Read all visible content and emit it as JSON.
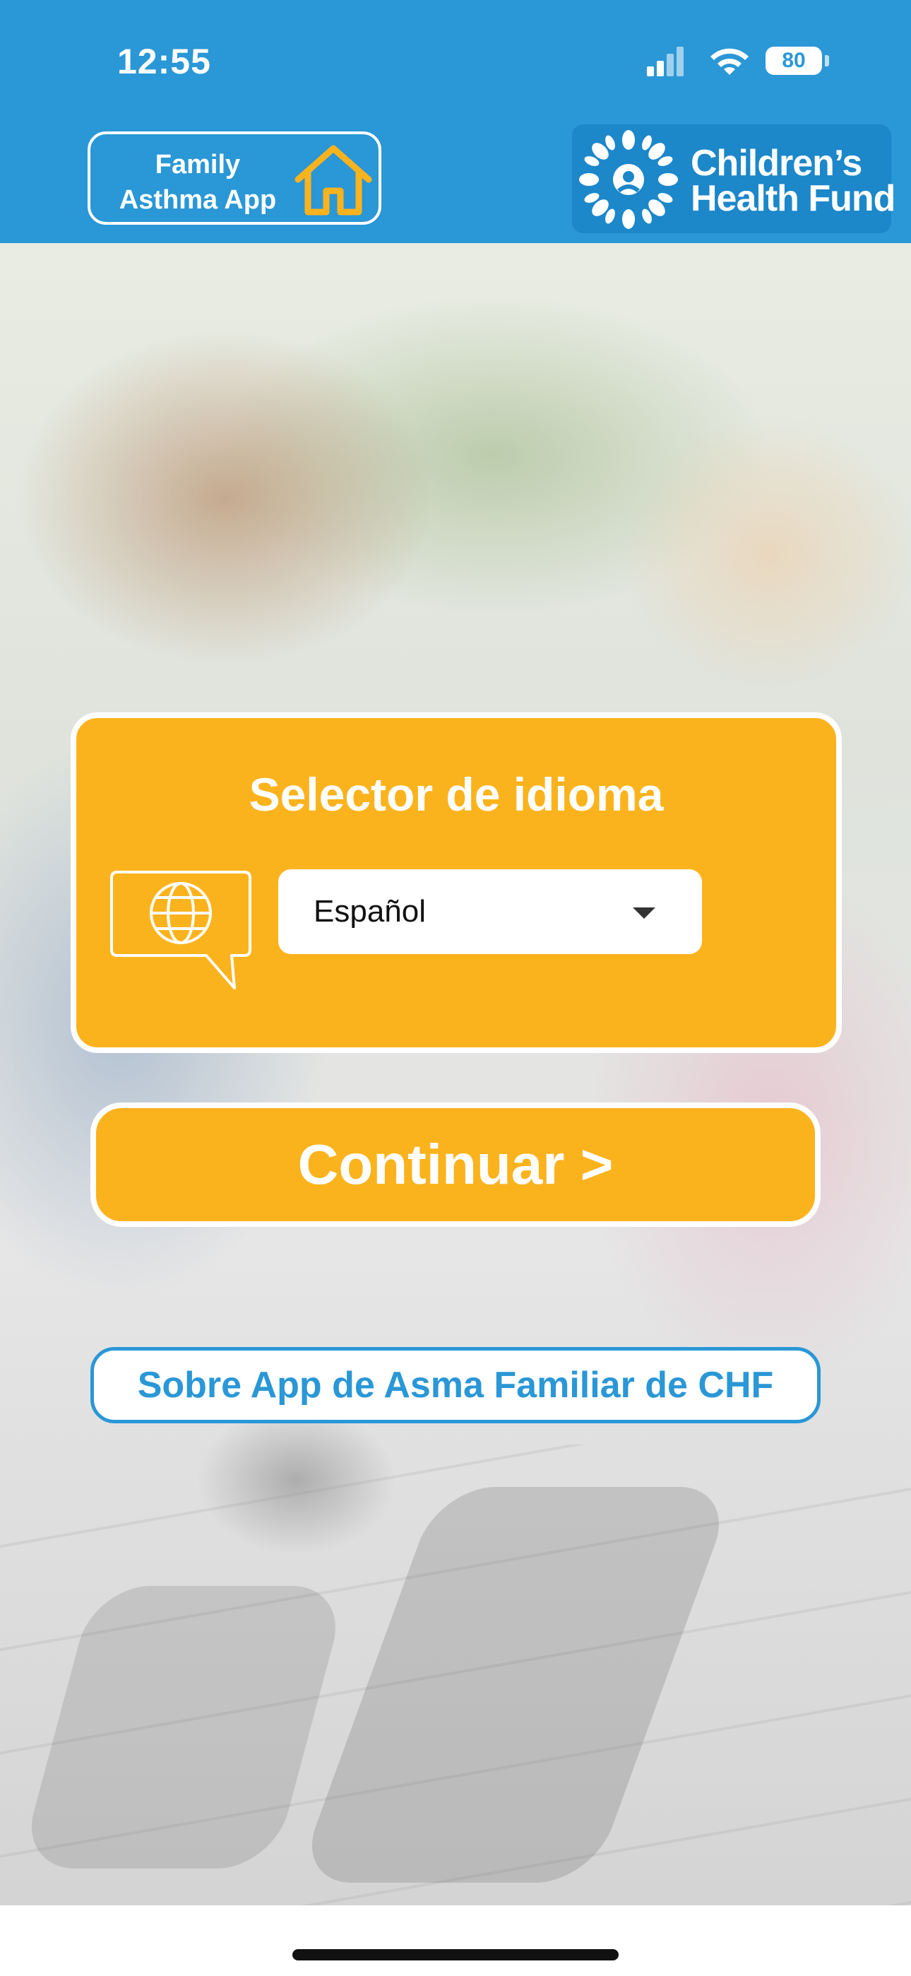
{
  "status_bar": {
    "time": "12:55",
    "battery": "80",
    "icons": [
      "cellular-signal-icon",
      "wifi-icon",
      "battery-icon"
    ]
  },
  "header": {
    "app_badge": {
      "line1": "Family",
      "line2": "Asthma App",
      "icon": "house-icon"
    },
    "org_logo": {
      "line1": "Children’s",
      "line2": "Health Fund",
      "icon": "sun-logo-icon"
    }
  },
  "language_card": {
    "title": "Selector de idioma",
    "icon": "globe-speech-bubble-icon",
    "selected_language": "Español"
  },
  "buttons": {
    "continue_label": "Continuar >",
    "about_label": "Sobre App de Asma Familiar de CHF"
  },
  "colors": {
    "header_blue": "#2a97d6",
    "accent_orange": "#fbb31d",
    "white": "#ffffff",
    "logo_blue": "#1c87c9"
  }
}
